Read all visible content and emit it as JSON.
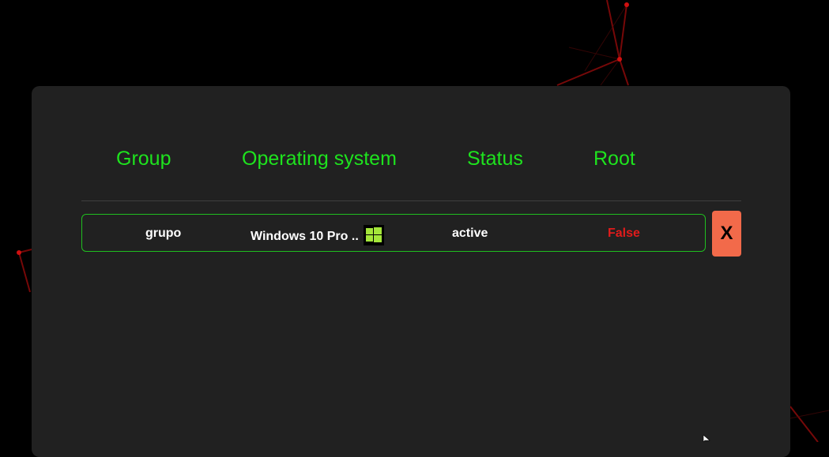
{
  "table": {
    "headers": {
      "group": "Group",
      "operating_system": "Operating system",
      "status": "Status",
      "root": "Root"
    },
    "rows": [
      {
        "group": "grupo",
        "operating_system": "Windows 10 Pro ..",
        "os_icon": "windows-logo-icon",
        "status": "active",
        "root": "False",
        "delete_label": "X"
      }
    ]
  },
  "colors": {
    "background": "#000000",
    "panel": "#212121",
    "accent": "#1ee31e",
    "root_false": "#e01b1b",
    "delete_button": "#f26a4a",
    "os_icon": "#a4e63a"
  }
}
